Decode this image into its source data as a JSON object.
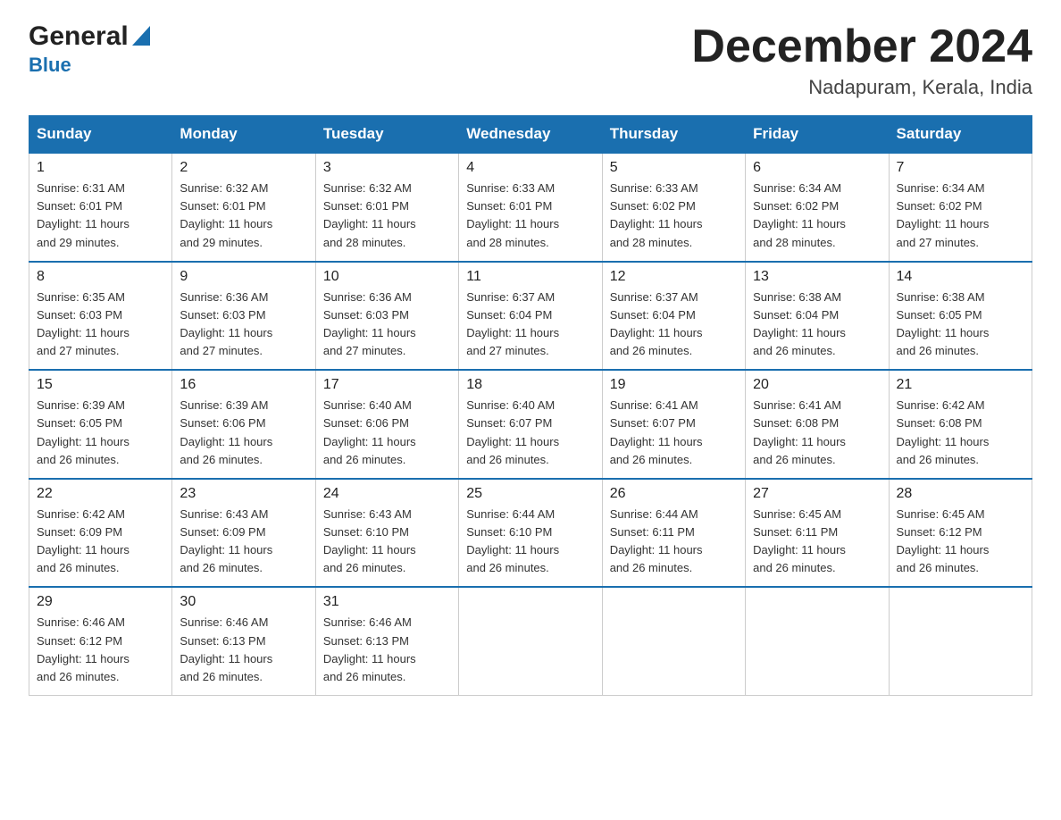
{
  "header": {
    "logo_general": "General",
    "logo_blue": "Blue",
    "month_title": "December 2024",
    "location": "Nadapuram, Kerala, India"
  },
  "days_of_week": [
    "Sunday",
    "Monday",
    "Tuesday",
    "Wednesday",
    "Thursday",
    "Friday",
    "Saturday"
  ],
  "weeks": [
    [
      {
        "day": "1",
        "sunrise": "6:31 AM",
        "sunset": "6:01 PM",
        "daylight": "11 hours and 29 minutes."
      },
      {
        "day": "2",
        "sunrise": "6:32 AM",
        "sunset": "6:01 PM",
        "daylight": "11 hours and 29 minutes."
      },
      {
        "day": "3",
        "sunrise": "6:32 AM",
        "sunset": "6:01 PM",
        "daylight": "11 hours and 28 minutes."
      },
      {
        "day": "4",
        "sunrise": "6:33 AM",
        "sunset": "6:01 PM",
        "daylight": "11 hours and 28 minutes."
      },
      {
        "day": "5",
        "sunrise": "6:33 AM",
        "sunset": "6:02 PM",
        "daylight": "11 hours and 28 minutes."
      },
      {
        "day": "6",
        "sunrise": "6:34 AM",
        "sunset": "6:02 PM",
        "daylight": "11 hours and 28 minutes."
      },
      {
        "day": "7",
        "sunrise": "6:34 AM",
        "sunset": "6:02 PM",
        "daylight": "11 hours and 27 minutes."
      }
    ],
    [
      {
        "day": "8",
        "sunrise": "6:35 AM",
        "sunset": "6:03 PM",
        "daylight": "11 hours and 27 minutes."
      },
      {
        "day": "9",
        "sunrise": "6:36 AM",
        "sunset": "6:03 PM",
        "daylight": "11 hours and 27 minutes."
      },
      {
        "day": "10",
        "sunrise": "6:36 AM",
        "sunset": "6:03 PM",
        "daylight": "11 hours and 27 minutes."
      },
      {
        "day": "11",
        "sunrise": "6:37 AM",
        "sunset": "6:04 PM",
        "daylight": "11 hours and 27 minutes."
      },
      {
        "day": "12",
        "sunrise": "6:37 AM",
        "sunset": "6:04 PM",
        "daylight": "11 hours and 26 minutes."
      },
      {
        "day": "13",
        "sunrise": "6:38 AM",
        "sunset": "6:04 PM",
        "daylight": "11 hours and 26 minutes."
      },
      {
        "day": "14",
        "sunrise": "6:38 AM",
        "sunset": "6:05 PM",
        "daylight": "11 hours and 26 minutes."
      }
    ],
    [
      {
        "day": "15",
        "sunrise": "6:39 AM",
        "sunset": "6:05 PM",
        "daylight": "11 hours and 26 minutes."
      },
      {
        "day": "16",
        "sunrise": "6:39 AM",
        "sunset": "6:06 PM",
        "daylight": "11 hours and 26 minutes."
      },
      {
        "day": "17",
        "sunrise": "6:40 AM",
        "sunset": "6:06 PM",
        "daylight": "11 hours and 26 minutes."
      },
      {
        "day": "18",
        "sunrise": "6:40 AM",
        "sunset": "6:07 PM",
        "daylight": "11 hours and 26 minutes."
      },
      {
        "day": "19",
        "sunrise": "6:41 AM",
        "sunset": "6:07 PM",
        "daylight": "11 hours and 26 minutes."
      },
      {
        "day": "20",
        "sunrise": "6:41 AM",
        "sunset": "6:08 PM",
        "daylight": "11 hours and 26 minutes."
      },
      {
        "day": "21",
        "sunrise": "6:42 AM",
        "sunset": "6:08 PM",
        "daylight": "11 hours and 26 minutes."
      }
    ],
    [
      {
        "day": "22",
        "sunrise": "6:42 AM",
        "sunset": "6:09 PM",
        "daylight": "11 hours and 26 minutes."
      },
      {
        "day": "23",
        "sunrise": "6:43 AM",
        "sunset": "6:09 PM",
        "daylight": "11 hours and 26 minutes."
      },
      {
        "day": "24",
        "sunrise": "6:43 AM",
        "sunset": "6:10 PM",
        "daylight": "11 hours and 26 minutes."
      },
      {
        "day": "25",
        "sunrise": "6:44 AM",
        "sunset": "6:10 PM",
        "daylight": "11 hours and 26 minutes."
      },
      {
        "day": "26",
        "sunrise": "6:44 AM",
        "sunset": "6:11 PM",
        "daylight": "11 hours and 26 minutes."
      },
      {
        "day": "27",
        "sunrise": "6:45 AM",
        "sunset": "6:11 PM",
        "daylight": "11 hours and 26 minutes."
      },
      {
        "day": "28",
        "sunrise": "6:45 AM",
        "sunset": "6:12 PM",
        "daylight": "11 hours and 26 minutes."
      }
    ],
    [
      {
        "day": "29",
        "sunrise": "6:46 AM",
        "sunset": "6:12 PM",
        "daylight": "11 hours and 26 minutes."
      },
      {
        "day": "30",
        "sunrise": "6:46 AM",
        "sunset": "6:13 PM",
        "daylight": "11 hours and 26 minutes."
      },
      {
        "day": "31",
        "sunrise": "6:46 AM",
        "sunset": "6:13 PM",
        "daylight": "11 hours and 26 minutes."
      },
      null,
      null,
      null,
      null
    ]
  ],
  "labels": {
    "sunrise": "Sunrise:",
    "sunset": "Sunset:",
    "daylight": "Daylight:"
  }
}
